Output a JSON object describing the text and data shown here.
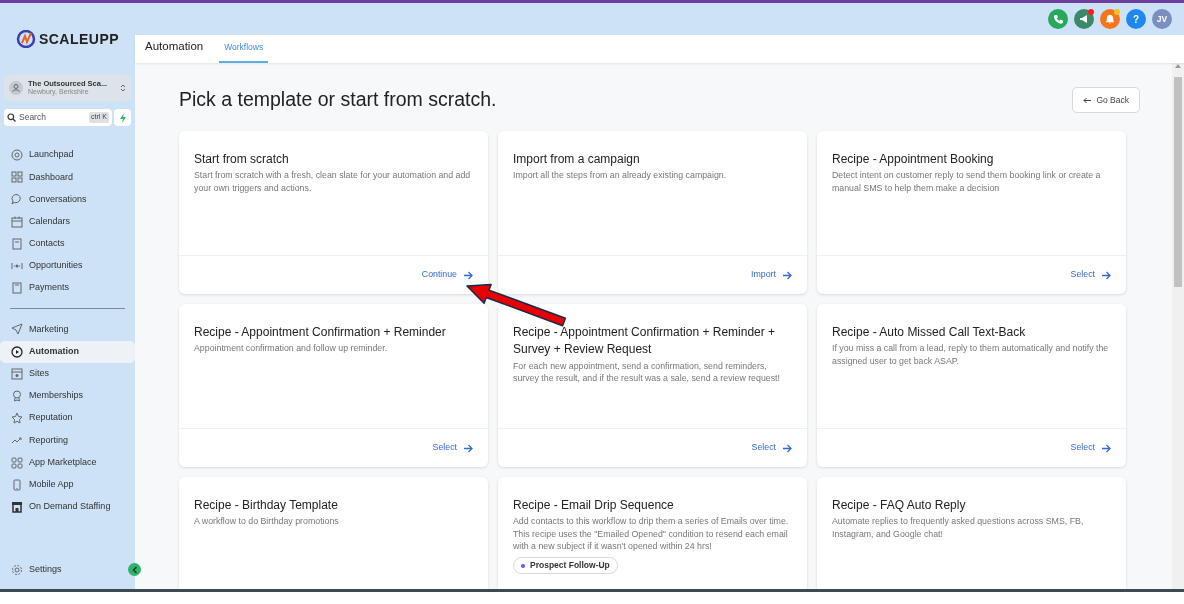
{
  "brand": {
    "name": "SCALEUPP"
  },
  "account": {
    "name": "The Outsourced Sca...",
    "location": "Newbury, Berkshire"
  },
  "search": {
    "placeholder": "Search",
    "shortcut": "ctrl K"
  },
  "sidebar": {
    "sections": [
      {
        "items": [
          {
            "label": "Launchpad",
            "selected": false
          },
          {
            "label": "Dashboard",
            "selected": false
          },
          {
            "label": "Conversations",
            "selected": false
          },
          {
            "label": "Calendars",
            "selected": false
          },
          {
            "label": "Contacts",
            "selected": false
          },
          {
            "label": "Opportunities",
            "selected": false
          },
          {
            "label": "Payments",
            "selected": false
          }
        ]
      },
      {
        "items": [
          {
            "label": "Marketing",
            "selected": false
          },
          {
            "label": "Automation",
            "selected": true
          },
          {
            "label": "Sites",
            "selected": false
          },
          {
            "label": "Memberships",
            "selected": false
          },
          {
            "label": "Reputation",
            "selected": false
          },
          {
            "label": "Reporting",
            "selected": false
          },
          {
            "label": "App Marketplace",
            "selected": false
          },
          {
            "label": "Mobile App",
            "selected": false
          },
          {
            "label": "On Demand Staffing",
            "selected": false
          }
        ]
      }
    ],
    "settings": "Settings"
  },
  "topbar": {
    "help": "?",
    "avatar": "JV"
  },
  "header": {
    "title": "Automation",
    "tabs": [
      {
        "label": "Workflows",
        "selected": true
      }
    ]
  },
  "page": {
    "title": "Pick a template or start from scratch.",
    "back_button": "Go Back"
  },
  "cards": [
    {
      "title": "Start from scratch",
      "description": "Start from scratch with a fresh, clean slate for your automation and add your own triggers and actions.",
      "action": "Continue"
    },
    {
      "title": "Import from a campaign",
      "description": "Import all the steps from an already existing campaign.",
      "action": "Import"
    },
    {
      "title": "Recipe - Appointment Booking",
      "description": "Detect intent on customer reply to send them booking link or create a manual SMS to help them make a decision",
      "action": "Select"
    },
    {
      "title": "Recipe - Appointment Confirmation + Reminder",
      "description": "Appointment confirmation and follow up reminder.",
      "action": "Select"
    },
    {
      "title": "Recipe - Appointment Confirmation + Reminder + Survey + Review Request",
      "description": "For each new appointment, send a confirmation, send reminders, survey the result, and if the result was a sale, send a review request!",
      "action": "Select"
    },
    {
      "title": "Recipe - Auto Missed Call Text-Back",
      "description": "If you miss a call from a lead, reply to them automatically and notify the assigned user to get back ASAP.",
      "action": "Select"
    },
    {
      "title": "Recipe - Birthday Template",
      "description": "A workflow to do Birthday promotions"
    },
    {
      "title": "Recipe - Email Drip Sequence",
      "description": "Add contacts to this workflow to drip them a series of Emails over time. This recipe uses the \"Emailed Opened\" condition to resend each email with a new subject if it wasn't opened within 24 hrs!",
      "tags": [
        {
          "label": "Prospect Follow-Up",
          "color": "#5a5cf0"
        }
      ]
    },
    {
      "title": "Recipe - FAQ Auto Reply",
      "description": "Automate replies to frequently asked questions across SMS, FB, Instagram, and Google chat!"
    }
  ]
}
